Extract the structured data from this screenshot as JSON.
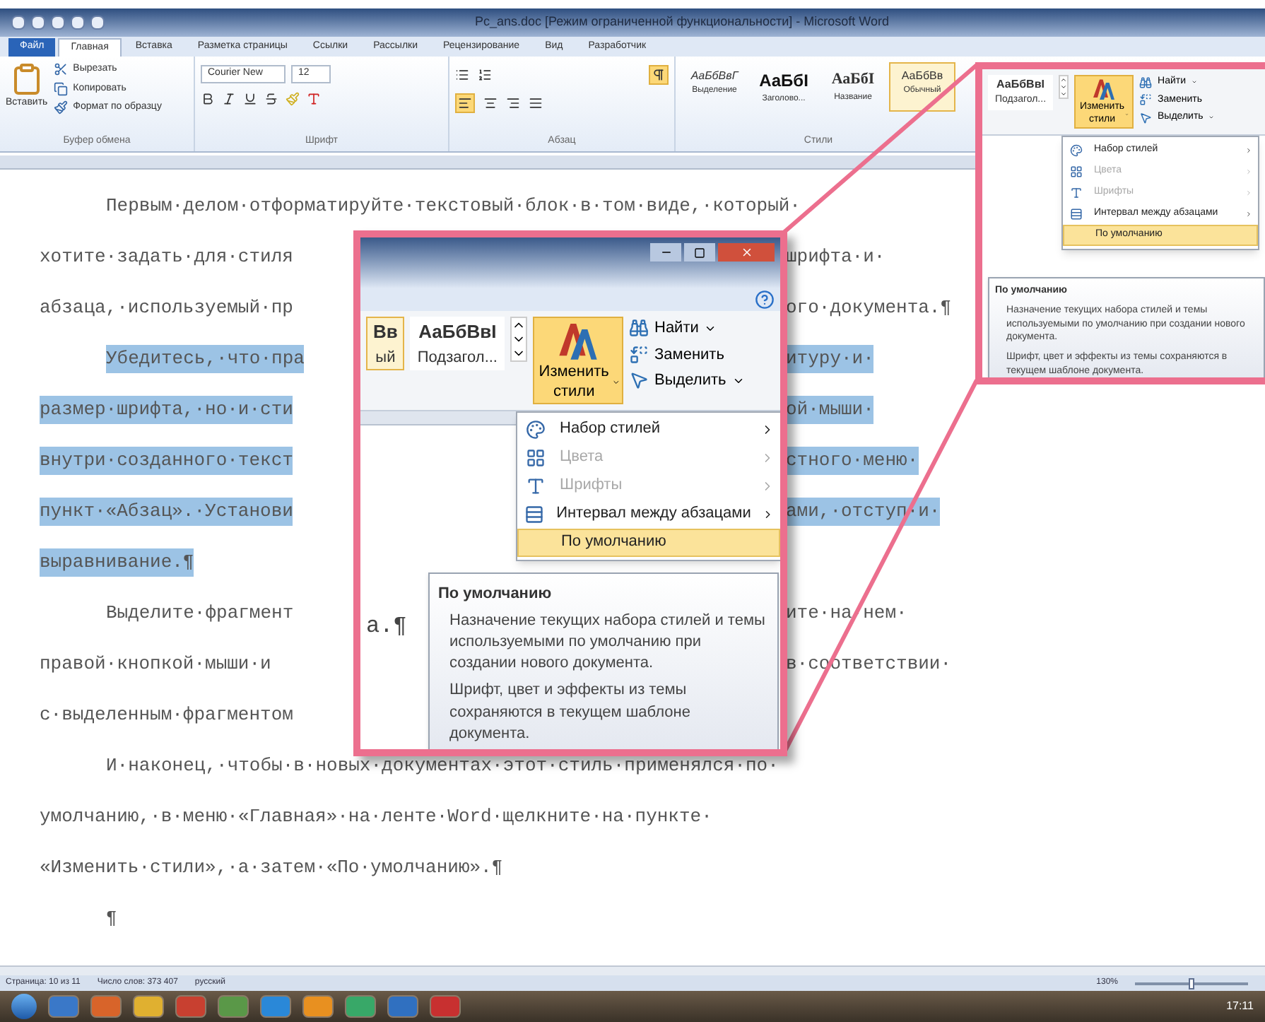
{
  "title_bar": {
    "title": "Pc_ans.doc [Режим ограниченной функциональности] - Microsoft Word"
  },
  "tabs": [
    {
      "label": "Файл",
      "kind": "file",
      "selected": false
    },
    {
      "label": "Главная",
      "kind": "tab",
      "selected": true
    },
    {
      "label": "Вставка",
      "kind": "tab",
      "selected": false
    },
    {
      "label": "Разметка страницы",
      "kind": "tab",
      "selected": false
    },
    {
      "label": "Ссылки",
      "kind": "tab",
      "selected": false
    },
    {
      "label": "Рассылки",
      "kind": "tab",
      "selected": false
    },
    {
      "label": "Рецензирование",
      "kind": "tab",
      "selected": false
    },
    {
      "label": "Вид",
      "kind": "tab",
      "selected": false
    },
    {
      "label": "Разработчик",
      "kind": "tab",
      "selected": false
    }
  ],
  "clipboard": {
    "paste": "Вставить",
    "items": [
      "Вырезать",
      "Копировать",
      "Формат по образцу"
    ],
    "group": "Буфер обмена"
  },
  "font": {
    "family": "Courier New",
    "size": "12",
    "group": "Шрифт"
  },
  "paragraph": {
    "group": "Абзац"
  },
  "styles": {
    "items": [
      {
        "sample": "АаБбВвГ",
        "name": "Выделение",
        "kind": "italic",
        "selected": false
      },
      {
        "sample": "АаБбІ",
        "name": "Заголово...",
        "kind": "heading",
        "selected": false
      },
      {
        "sample": "АаБбІ",
        "name": "Название",
        "kind": "title",
        "selected": false
      },
      {
        "sample": "АаБбВв",
        "name": "Обычный",
        "kind": "normal",
        "selected": true
      }
    ],
    "group": "Стили"
  },
  "document": {
    "lines": [
      {
        "left": "Первым·делом·отформатируйте·текстовый·блок·в·том·виде,·который·",
        "indent": true,
        "highlighted": false
      },
      {
        "left": "хотите·задать·для·стиля",
        "right": "шрифта·и·",
        "indent": false,
        "highlighted": false
      },
      {
        "left": "абзаца,·используемый·пр",
        "right": "ого·документа.¶",
        "indent": false,
        "highlighted": false
      },
      {
        "left": "Убедитесь,·что·пра",
        "right": "итуру·и·",
        "indent": true,
        "highlighted": true
      },
      {
        "left": "размер·шрифта,·но·и·сти",
        "right": "ой·мыши·",
        "indent": false,
        "highlighted": true
      },
      {
        "left": "внутри·созданного·текст",
        "right": "стного·меню·",
        "indent": false,
        "highlighted": true
      },
      {
        "left": "пункт·«Абзац».·Установи",
        "right": "ами,·отступ·и·",
        "indent": false,
        "highlighted": true
      },
      {
        "left": "выравнивание.¶",
        "indent": false,
        "highlighted": true
      },
      {
        "left": "Выделите·фрагмент",
        "right": "ите·на·нем·",
        "indent": true,
        "highlighted": false
      },
      {
        "left": "правой·кнопкой·мыши·и",
        "right": "в·соответствии·",
        "indent": false,
        "highlighted": false
      },
      {
        "left": "с·выделенным·фрагментом",
        "indent": false,
        "highlighted": false
      },
      {
        "left": "И·наконец,·чтобы·в·новых·документах·этот·стиль·применялся·по·",
        "indent": true,
        "highlighted": false
      },
      {
        "left": "умолчанию,·в·меню·«Главная»·на·ленте·Word·щелкните·на·пункте·",
        "indent": false,
        "highlighted": false
      },
      {
        "left": "«Изменить·стили»,·а·затем·«По·умолчанию».¶",
        "indent": false,
        "highlighted": false
      },
      {
        "left": "¶",
        "indent": true,
        "highlighted": false
      }
    ]
  },
  "inset": {
    "styles": [
      {
        "sample": "Вв",
        "name": "ый",
        "selected": true
      },
      {
        "sample": "АаБбВвІ",
        "name": "Подзагол...",
        "selected": false
      }
    ],
    "change_styles": "Изменить стили",
    "edit": [
      {
        "label": "Найти",
        "dropdown": true
      },
      {
        "label": "Заменить",
        "dropdown": false
      },
      {
        "label": "Выделить",
        "dropdown": true
      }
    ],
    "doc_text": "а.¶",
    "menu": [
      {
        "label": "Набор стилей",
        "kind": "set",
        "disabled": false,
        "selected": false
      },
      {
        "label": "Цвета",
        "kind": "colors",
        "disabled": true,
        "selected": false
      },
      {
        "label": "Шрифты",
        "kind": "fonts",
        "disabled": true,
        "selected": false
      },
      {
        "label": "Интервал между абзацами",
        "kind": "spacing",
        "disabled": false,
        "selected": false
      },
      {
        "label": "По умолчанию",
        "kind": "plain",
        "disabled": false,
        "selected": true
      }
    ],
    "tooltip": {
      "title": "По умолчанию",
      "paragraphs": [
        "Назначение текущих набора стилей и темы используемыми по умолчанию при создании нового документа.",
        "Шрифт, цвет и эффекты из темы сохраняются в текущем шаблоне документа."
      ]
    }
  },
  "callout": {
    "styles": [
      {
        "sample": "АаБбВвІ",
        "name": "Подзагол...",
        "selected": false
      }
    ],
    "change_styles": "Изменить стили",
    "edit": [
      {
        "label": "Найти",
        "dropdown": true
      },
      {
        "label": "Заменить",
        "dropdown": false
      },
      {
        "label": "Выделить",
        "dropdown": true
      }
    ],
    "menu": [
      {
        "label": "Набор стилей",
        "kind": "set",
        "disabled": false,
        "selected": false
      },
      {
        "label": "Цвета",
        "kind": "colors",
        "disabled": true,
        "selected": false
      },
      {
        "label": "Шрифты",
        "kind": "fonts",
        "disabled": true,
        "selected": false
      },
      {
        "label": "Интервал между абзацами",
        "kind": "spacing",
        "disabled": false,
        "selected": false
      },
      {
        "label": "По умолчанию",
        "kind": "plain",
        "disabled": false,
        "selected": true
      }
    ],
    "tooltip": {
      "title": "По умолчанию",
      "paragraphs": [
        "Назначение текущих набора стилей и темы используемыми по умолчанию при создании нового документа.",
        "Шрифт, цвет и эффекты из темы сохраняются в текущем шаблоне документа."
      ]
    }
  },
  "status_bar": {
    "items": [
      "Страница: 10 из 11",
      "Число слов: 373 407",
      "русский"
    ],
    "zoom": "130%",
    "level": 0.5
  },
  "taskbar": {
    "clock": "17:11"
  }
}
